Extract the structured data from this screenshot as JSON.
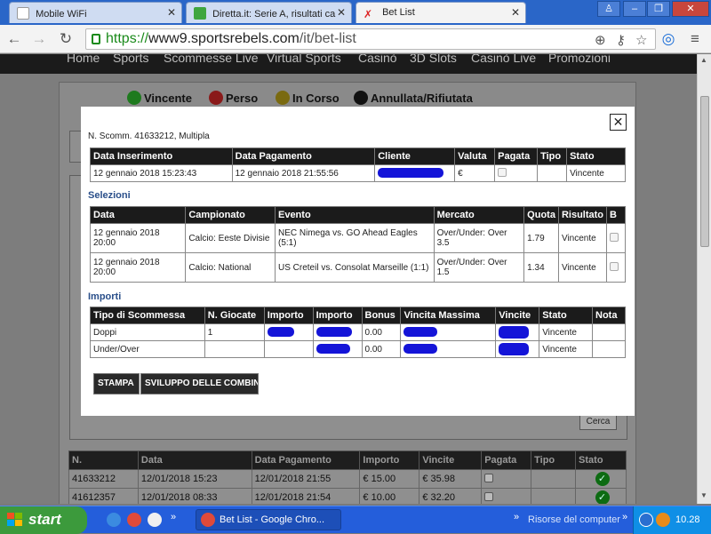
{
  "browser": {
    "tabs": [
      {
        "title": "Mobile WiFi",
        "active": false
      },
      {
        "title": "Diretta.it: Serie A, risultati ca",
        "active": false
      },
      {
        "title": "Bet List",
        "active": true
      }
    ],
    "url_scheme": "https://",
    "url_host": "www9.sportsrebels.com",
    "url_path": "/it/bet-list"
  },
  "site": {
    "nav": [
      "Home",
      "Sports",
      "Scommesse Live",
      "Virtual Sports",
      "Casinò",
      "3D Slots",
      "Casinò Live",
      "Promozioni"
    ],
    "legend": [
      "Vincente",
      "Perso",
      "In Corso",
      "Annullata/Rifiutata"
    ],
    "search_button": "Cerca",
    "list": {
      "headers": [
        "N.",
        "Data",
        "Data Pagamento",
        "Importo",
        "Vincite",
        "Pagata",
        "Tipo",
        "Stato"
      ],
      "rows": [
        {
          "n": "41633212",
          "data": "12/01/2018 15:23",
          "pagamento": "12/01/2018 21:55",
          "importo": "€ 15.00",
          "vincite": "€ 35.98"
        },
        {
          "n": "41612357",
          "data": "12/01/2018 08:33",
          "pagamento": "12/01/2018 21:54",
          "importo": "€ 10.00",
          "vincite": "€ 32.20"
        }
      ]
    }
  },
  "modal": {
    "close_symbol": "✕",
    "ref": "N. Scomm. 41633212, Multipla",
    "info": {
      "headers": [
        "Data Inserimento",
        "Data Pagamento",
        "Cliente",
        "Valuta",
        "Pagata",
        "Tipo",
        "Stato"
      ],
      "row": {
        "inserimento": "12 gennaio 2018 15:23:43",
        "pagamento": "12 gennaio 2018 21:55:56",
        "valuta": "€",
        "tipo": "",
        "stato": "Vincente"
      }
    },
    "selezioni_title": "Selezioni",
    "selezioni": {
      "headers": [
        "Data",
        "Campionato",
        "Evento",
        "Mercato",
        "Quota",
        "Risultato",
        "B"
      ],
      "rows": [
        {
          "data": "12 gennaio 2018 20:00",
          "campionato": "Calcio: Eeste Divisie",
          "evento": "NEC Nimega vs. GO Ahead Eagles (5:1)",
          "mercato": "Over/Under: Over 3.5",
          "quota": "1.79",
          "risultato": "Vincente"
        },
        {
          "data": "12 gennaio 2018 20:00",
          "campionato": "Calcio: National",
          "evento": "US Creteil vs. Consolat Marseille (1:1)",
          "mercato": "Over/Under: Over 1.5",
          "quota": "1.34",
          "risultato": "Vincente"
        }
      ]
    },
    "importi_title": "Importi",
    "importi": {
      "headers": [
        "Tipo di Scommessa",
        "N. Giocate",
        "Importo",
        "Importo",
        "Bonus",
        "Vincita Massima",
        "Vincite",
        "Stato",
        "Nota"
      ],
      "rows": [
        {
          "tipo": "Doppi",
          "giocate": "1",
          "bonus": "0.00",
          "stato": "Vincente"
        },
        {
          "tipo": "Under/Over",
          "giocate": "",
          "bonus": "0.00",
          "stato": "Vincente"
        }
      ]
    },
    "buttons": {
      "stampa": "STAMPA",
      "sviluppo": "SVILUPPO DELLE COMBIN"
    }
  },
  "taskbar": {
    "start": "start",
    "task": "Bet List - Google Chro...",
    "tray_label": "Risorse del computer",
    "clock": "10.28"
  },
  "colors": {
    "accent": "#2a8a2a",
    "header": "#1b1b1b",
    "section": "#2a4f8a",
    "redaction": "#1414d8"
  }
}
